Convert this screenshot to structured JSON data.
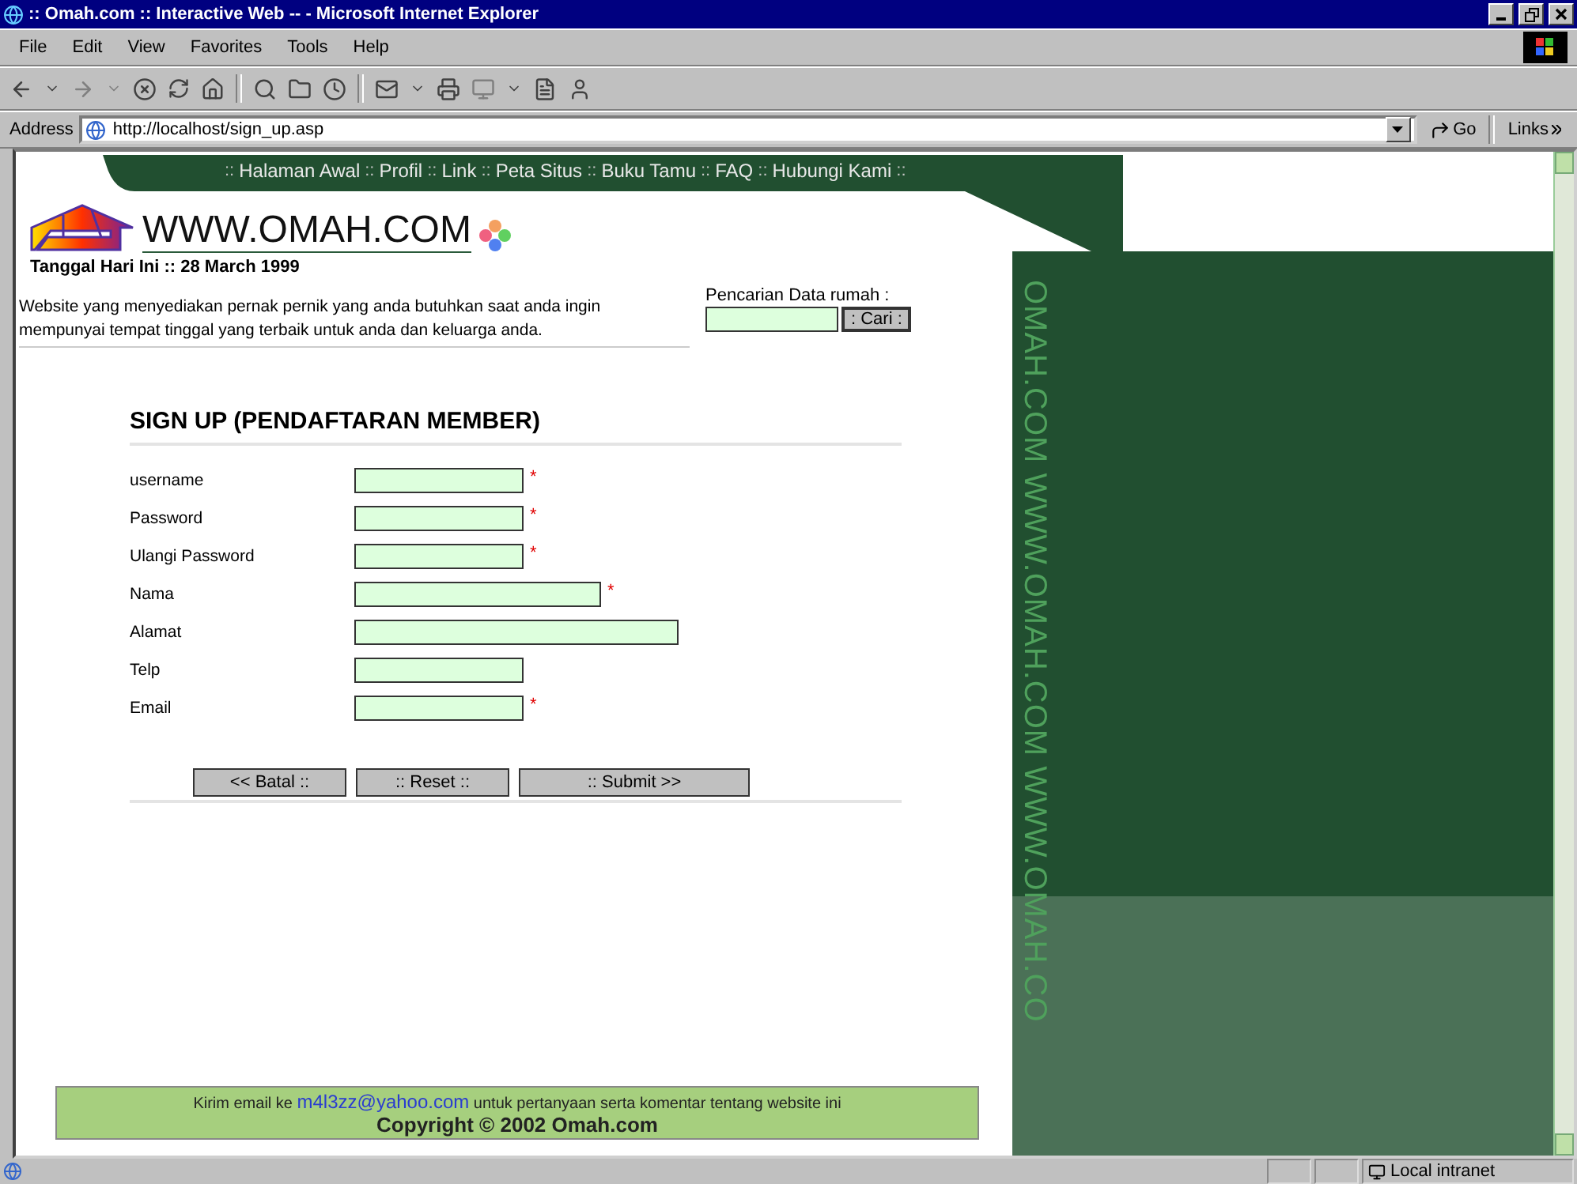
{
  "window": {
    "title": ":: Omah.com :: Interactive Web -- - Microsoft Internet Explorer"
  },
  "menu": [
    "File",
    "Edit",
    "View",
    "Favorites",
    "Tools",
    "Help"
  ],
  "address_bar": {
    "label": "Address",
    "url": "http://localhost/sign_up.asp",
    "go": "Go",
    "links": "Links"
  },
  "page": {
    "nav_separator": "::",
    "nav": [
      "Halaman Awal",
      "Profil",
      "Link",
      "Peta Situs",
      "Buku Tamu",
      "FAQ",
      "Hubungi Kami"
    ],
    "logo_text": "WWW.OMAH.COM",
    "date": "Tanggal Hari Ini :: 28 March 1999",
    "tagline": "Website yang menyediakan pernak pernik yang anda butuhkan saat anda ingin mempunyai tempat tinggal yang terbaik untuk anda dan keluarga anda.",
    "search": {
      "label": "Pencarian Data rumah :",
      "button": ": Cari :"
    },
    "form": {
      "title": "SIGN UP (PENDAFTARAN MEMBER)",
      "fields": [
        {
          "label": "username",
          "kind": "short",
          "mark": "*"
        },
        {
          "label": "Password",
          "kind": "short",
          "mark": "*"
        },
        {
          "label": "Ulangi Password",
          "kind": "short",
          "mark": "*"
        },
        {
          "label": "Nama",
          "kind": "medium",
          "mark": "*"
        },
        {
          "label": "Alamat",
          "kind": "long"
        },
        {
          "label": "Telp",
          "kind": "short"
        },
        {
          "label": "Email",
          "kind": "short",
          "mark": "*"
        }
      ],
      "buttons": [
        {
          "label": "<< Batal ::",
          "kind": "short"
        },
        {
          "label": ":: Reset ::",
          "kind": "short"
        },
        {
          "label": ":: Submit >>",
          "kind": "wide"
        }
      ]
    },
    "footer": {
      "before": "Kirim email ke ",
      "email": "m4l3zz@yahoo.com",
      "after": " untuk pertanyaan serta komentar tentang website ini",
      "copyright": "Copyright © 2002 Omah.com"
    },
    "side_text": "OMAH.COM WWW.OMAH.COM WWW.OMAH.CO"
  },
  "status_bar": {
    "zone": "Local intranet"
  }
}
